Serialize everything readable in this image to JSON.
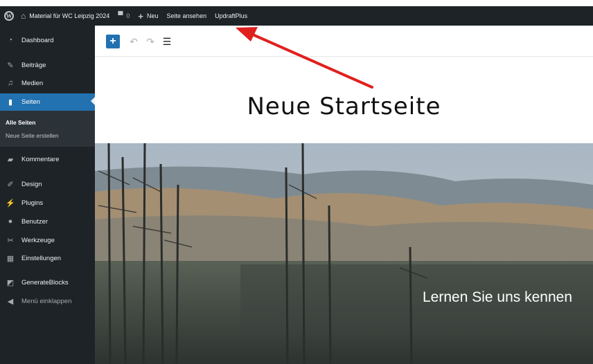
{
  "adminbar": {
    "wp_logo": "W",
    "home_icon": "house-icon",
    "site_name": "Material für WC Leipzig 2024",
    "comments_icon": "comment-bubble-icon",
    "comments_count": "0",
    "new_icon": "plus-icon",
    "new_label": "Neu",
    "view_page": "Seite ansehen",
    "plugin": "UpdraftPlus"
  },
  "sidebar": {
    "items": [
      {
        "label": "Dashboard",
        "icon": "dashboard-icon"
      },
      {
        "label": "Beiträge",
        "icon": "pin-icon"
      },
      {
        "label": "Medien",
        "icon": "media-icon"
      },
      {
        "label": "Seiten",
        "icon": "pages-icon",
        "current": true
      },
      {
        "label": "Kommentare",
        "icon": "comment-icon"
      },
      {
        "label": "Design",
        "icon": "brush-icon"
      },
      {
        "label": "Plugins",
        "icon": "plugin-icon"
      },
      {
        "label": "Benutzer",
        "icon": "user-icon"
      },
      {
        "label": "Werkzeuge",
        "icon": "wrench-icon"
      },
      {
        "label": "Einstellungen",
        "icon": "settings-icon"
      },
      {
        "label": "GenerateBlocks",
        "icon": "generateblocks-icon"
      },
      {
        "label": "Menü einklappen",
        "icon": "collapse-icon"
      }
    ],
    "submenu": [
      {
        "label": "Alle Seiten",
        "active": true
      },
      {
        "label": "Neue Seite erstellen",
        "active": false
      }
    ]
  },
  "editor": {
    "toolbar": {
      "add_icon": "plus-icon",
      "undo_icon": "undo-icon",
      "redo_icon": "redo-icon",
      "list_view_icon": "list-view-icon"
    },
    "page_title": "Neue Startseite",
    "hero_text": "Lernen Sie uns kennen"
  },
  "colors": {
    "adminbar_bg": "#1d2327",
    "sidebar_bg": "#1d2327",
    "accent": "#2271b1",
    "annotation_arrow": "#e0201e"
  }
}
